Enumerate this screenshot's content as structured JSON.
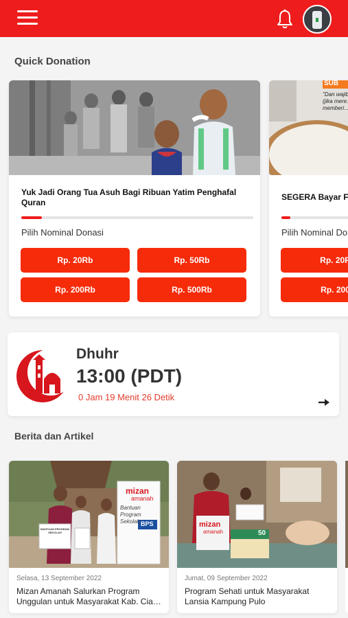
{
  "header": {
    "menu_icon": "hamburger-icon",
    "bell_icon": "bell-icon",
    "avatar": "user-avatar",
    "brand_color": "#ee1c1c"
  },
  "quick_donation": {
    "title": "Quick Donation",
    "cards": [
      {
        "title": "Yuk Jadi Orang Tua Asuh Bagi Ribuan Yatim Penghafal Quran",
        "progress": 0.09,
        "nominal_label": "Pilih Nominal Donasi",
        "amounts": [
          "Rp. 20Rb",
          "Rp. 50Rb",
          "Rp. 200Rb",
          "Rp. 500Rb"
        ]
      },
      {
        "title": "SEGERA Bayar F",
        "image_text": "\"Dan wajib... (jika mere... memberi...",
        "badge": "SUB",
        "progress": 0.09,
        "nominal_label": "Pilih Nominal Do",
        "amounts": [
          "Rp. 20R",
          "Rp. 200"
        ]
      }
    ]
  },
  "prayer": {
    "name": "Dhuhr",
    "time": "13:00 (PDT)",
    "countdown": "0 Jam 19 Menit 26 Detik",
    "icon": "mosque-crescent-icon",
    "arrow_icon": "arrow-right-icon"
  },
  "news": {
    "title": "Berita dan Artikel",
    "items": [
      {
        "date": "Selasa, 13 September 2022",
        "title": "Mizan Amanah Salurkan Program Unggulan untuk Masyarakat Kab. Cia…",
        "banner_brand": "mizan",
        "banner_sub": "amanah",
        "banner_text": "Bantuan Program Sekolah",
        "banner_badge": "BPS",
        "held_sign": "BANTUAN PROGRAM SEKOLAH"
      },
      {
        "date": "Jumat, 09 September 2022",
        "title": "Program Sehati untuk Masyarakat Lansia Kampung Pulo",
        "bag_brand": "mizan",
        "bag_sub": "amanah",
        "box_number": "50"
      }
    ]
  }
}
